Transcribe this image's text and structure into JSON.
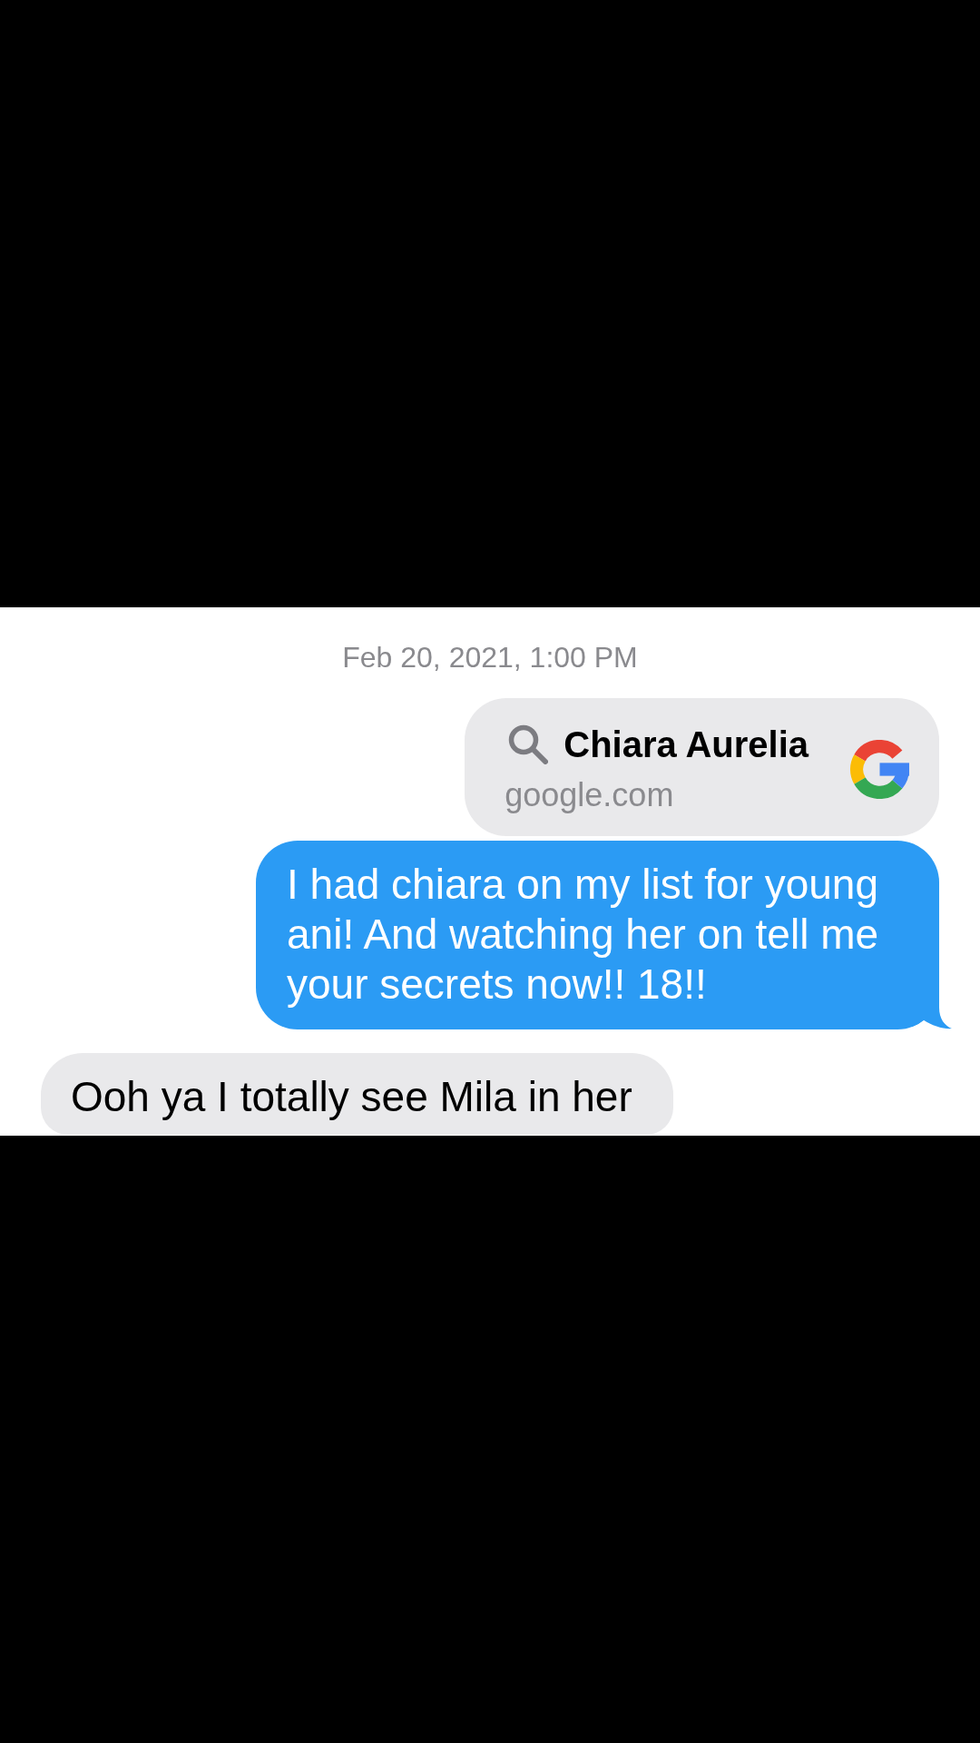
{
  "timestamp": "Feb 20, 2021, 1:00 PM",
  "messages": [
    {
      "kind": "link",
      "title": "Chiara Aurelia",
      "domain": "google.com"
    },
    {
      "kind": "sent",
      "text": "I had chiara on my list for young ani! And watching her on tell me your secrets now!! 18!!"
    },
    {
      "kind": "received",
      "text": "Ooh ya I totally see Mila in her"
    }
  ]
}
